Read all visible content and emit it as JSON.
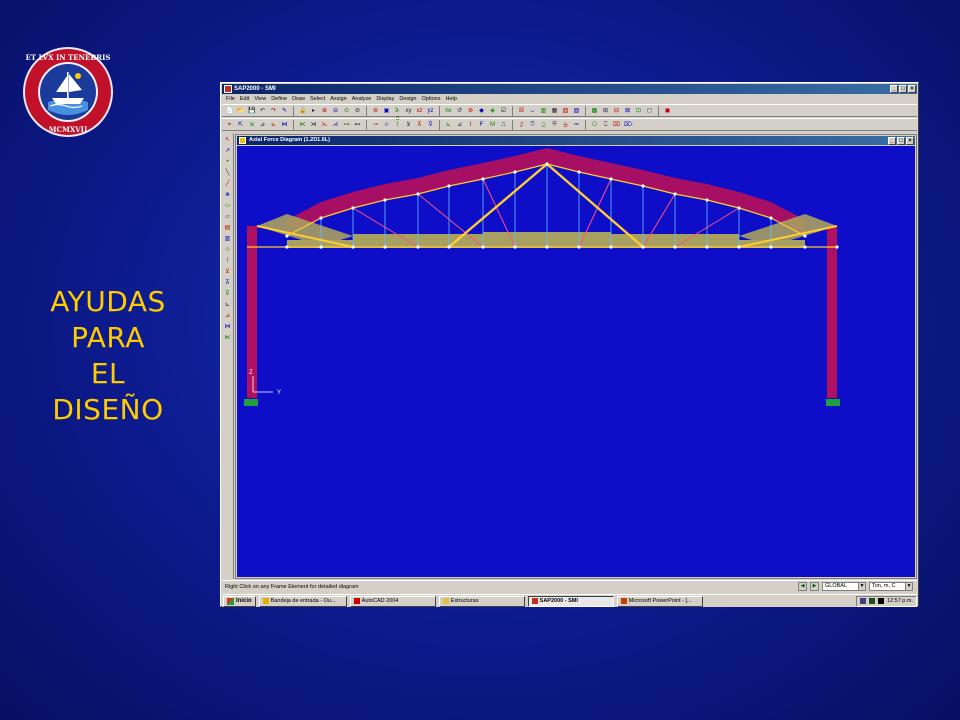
{
  "slide": {
    "side_title": [
      "AYUDAS",
      "PARA",
      "EL",
      "DISEÑO"
    ],
    "title_color": "#ffcc00",
    "logo": {
      "motto": "ET LVX IN TENEBRIS LVCET",
      "year": "MCMXVII"
    }
  },
  "app": {
    "title": "SAP2000 - SMI",
    "window_buttons": [
      "_",
      "□",
      "×"
    ],
    "menu": [
      "File",
      "Edit",
      "View",
      "Define",
      "Draw",
      "Select",
      "Assign",
      "Analyze",
      "Display",
      "Design",
      "Options",
      "Help"
    ],
    "toolbar1": [
      "📄",
      "📂",
      "💾",
      "↶",
      "↷",
      "✎",
      "🔒",
      "▸",
      "⊕",
      "⊖",
      "⊙",
      "⊘",
      "⊚",
      "▣",
      "3-d",
      "xy",
      "xz",
      "yz",
      "nv",
      "↺",
      "⊛",
      "◆",
      "◈",
      "☑",
      "☒",
      "↔",
      "▥",
      "▦",
      "▧",
      "▨",
      "▩",
      "⊞",
      "⊟",
      "⊠",
      "⊡",
      "◻",
      "◼"
    ],
    "toolbar2": [
      "⌖",
      "⇱",
      "⇲",
      "⊿",
      "⊾",
      "⋈",
      "⋉",
      "⋊",
      "⋋",
      "⋌",
      "⊶",
      "⊷",
      "⊸",
      "⊹",
      "⊺",
      "⊻",
      "⊼",
      "⊽",
      "⊾",
      "⊿",
      "I",
      "F",
      "M",
      "⎍",
      "⎎",
      "⎏",
      "⎐",
      "⎑",
      "⎒",
      "⎓",
      "⎔",
      "⎕",
      "⌧",
      "⌦"
    ],
    "left_tools": [
      "↖",
      "↗",
      "•",
      "╲",
      "╱",
      "⋇",
      "▭",
      "▱",
      "▤",
      "▥",
      "⊹",
      "⊺",
      "⊻",
      "⊼",
      "⊽",
      "⊾",
      "⊿",
      "⋈",
      "⋉"
    ],
    "doc_title": "Axial Force Diagram   (1.2D1.6L)",
    "status_text": "Right Click on any Frame Element for detailed diagram",
    "coord_system": "GLOBAL",
    "units": "Ton, m, C",
    "taskbar": {
      "start": "Inicio",
      "tasks": [
        {
          "label": "Bandeja de entrada - Ou...",
          "color": "#e0b000"
        },
        {
          "label": "AutoCAD 2004",
          "color": "#c00000"
        },
        {
          "label": "Estructuras",
          "color": "#e0c040"
        },
        {
          "label": "SAP2000 - SMI",
          "color": "#c03020",
          "active": true
        },
        {
          "label": "Microsoft PowerPoint - [...",
          "color": "#c04000"
        }
      ],
      "clock": "12:57 p.m."
    },
    "axis_labels": {
      "z": "Z",
      "y": "Y"
    }
  },
  "colors": {
    "canvas_bg": "#0e0ec8",
    "tension": "#b01060",
    "compression": "#a8a060",
    "member": "#ffcc33",
    "joint": "#ffffff",
    "support": "#20a040"
  }
}
